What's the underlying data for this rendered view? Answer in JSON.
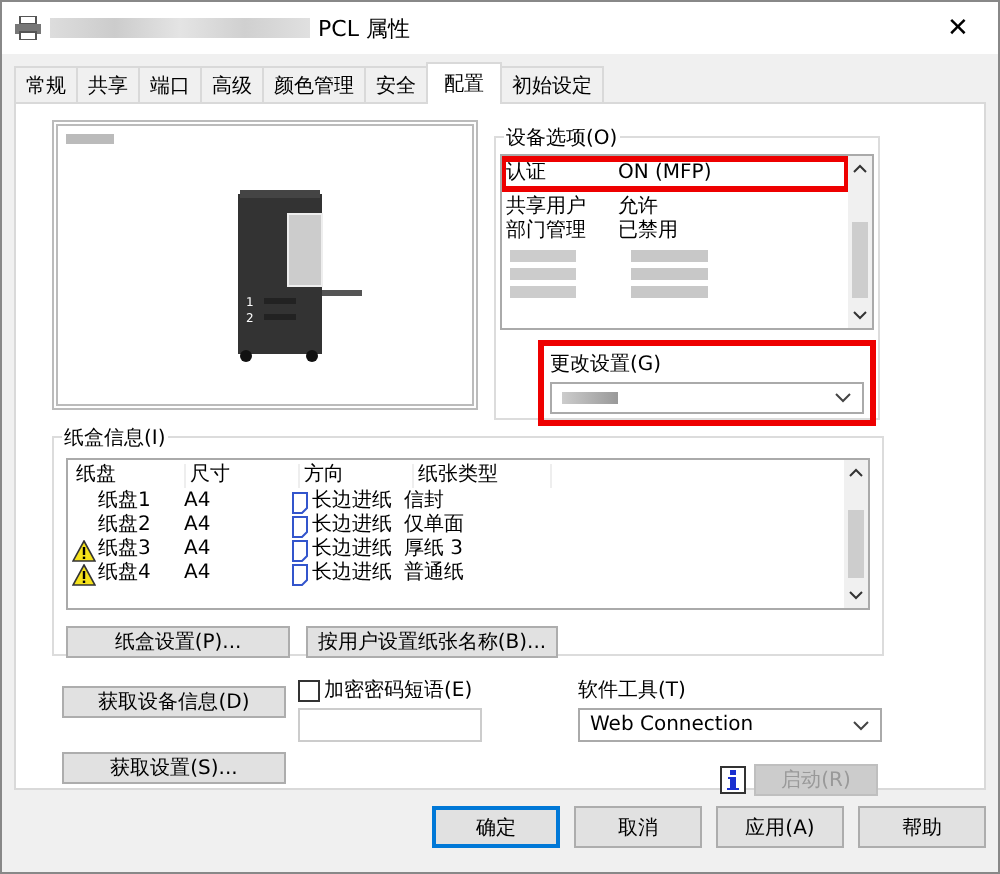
{
  "window": {
    "title": "PCL 属性",
    "close": "✕"
  },
  "tabs": [
    {
      "label": "常规",
      "selected": false
    },
    {
      "label": "共享",
      "selected": false
    },
    {
      "label": "端口",
      "selected": false
    },
    {
      "label": "高级",
      "selected": false
    },
    {
      "label": "颜色管理",
      "selected": false
    },
    {
      "label": "安全",
      "selected": false
    },
    {
      "label": "配置",
      "selected": true
    },
    {
      "label": "初始设定",
      "selected": false
    }
  ],
  "preview": {
    "tray_labels": [
      "1",
      "2"
    ]
  },
  "device_options": {
    "label": "设备选项(O)",
    "rows": [
      {
        "name": "认证",
        "value": "ON (MFP)",
        "highlighted": true
      },
      {
        "name": "共享用户",
        "value": "允许",
        "highlighted": false
      },
      {
        "name": "部门管理",
        "value": "已禁用",
        "highlighted": false
      }
    ]
  },
  "change_setting": {
    "label": "更改设置(G)",
    "highlighted": true
  },
  "tray_info": {
    "label": "纸盒信息(I)",
    "columns": [
      "纸盘",
      "尺寸",
      "方向",
      "纸张类型"
    ],
    "rows": [
      {
        "tray": "纸盘1",
        "size": "A4",
        "orientation": "长边进纸",
        "paper_type": "信封",
        "warning": false
      },
      {
        "tray": "纸盘2",
        "size": "A4",
        "orientation": "长边进纸",
        "paper_type": "仅单面",
        "warning": false
      },
      {
        "tray": "纸盘3",
        "size": "A4",
        "orientation": "长边进纸",
        "paper_type": "厚纸 3",
        "warning": true
      },
      {
        "tray": "纸盘4",
        "size": "A4",
        "orientation": "长边进纸",
        "paper_type": "普通纸",
        "warning": true
      }
    ],
    "buttons": [
      "纸盒设置(P)...",
      "按用户设置纸张名称(B)..."
    ]
  },
  "get_device_info": {
    "label": "获取设备信息(D)"
  },
  "get_settings": {
    "label": "获取设置(S)..."
  },
  "encrypt": {
    "label": "加密密码短语(E)",
    "checked": false
  },
  "software_tools": {
    "label": "软件工具(T)",
    "value": "Web Connection"
  },
  "launch": {
    "label": "启动(R)",
    "disabled": true
  },
  "footer": [
    {
      "label": "确定",
      "default": true
    },
    {
      "label": "取消",
      "default": false
    },
    {
      "label": "应用(A)",
      "default": false
    },
    {
      "label": "帮助",
      "default": false
    }
  ]
}
